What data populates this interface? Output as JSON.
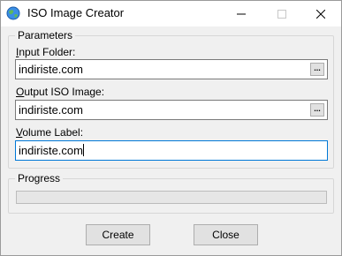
{
  "window": {
    "title": "ISO Image Creator",
    "icon": "globe-icon",
    "controls": [
      "minimize-icon",
      "maximize-icon",
      "close-icon"
    ]
  },
  "parameters": {
    "legend": "Parameters",
    "input_folder": {
      "accel": "I",
      "label_rest": "nput Folder:",
      "value": "indiriste.com",
      "browse_label": "..."
    },
    "output_iso": {
      "accel": "O",
      "label_rest": "utput ISO Image:",
      "value": "indiriste.com",
      "browse_label": "..."
    },
    "volume_label": {
      "accel": "V",
      "label_rest": "olume Label:",
      "value": "indiriste.com"
    }
  },
  "progress": {
    "legend": "Progress",
    "fraction": 0
  },
  "buttons": {
    "create": "Create",
    "close": "Close"
  },
  "colors": {
    "window_bg": "#f0f0f0",
    "focus_border": "#0078d7"
  }
}
